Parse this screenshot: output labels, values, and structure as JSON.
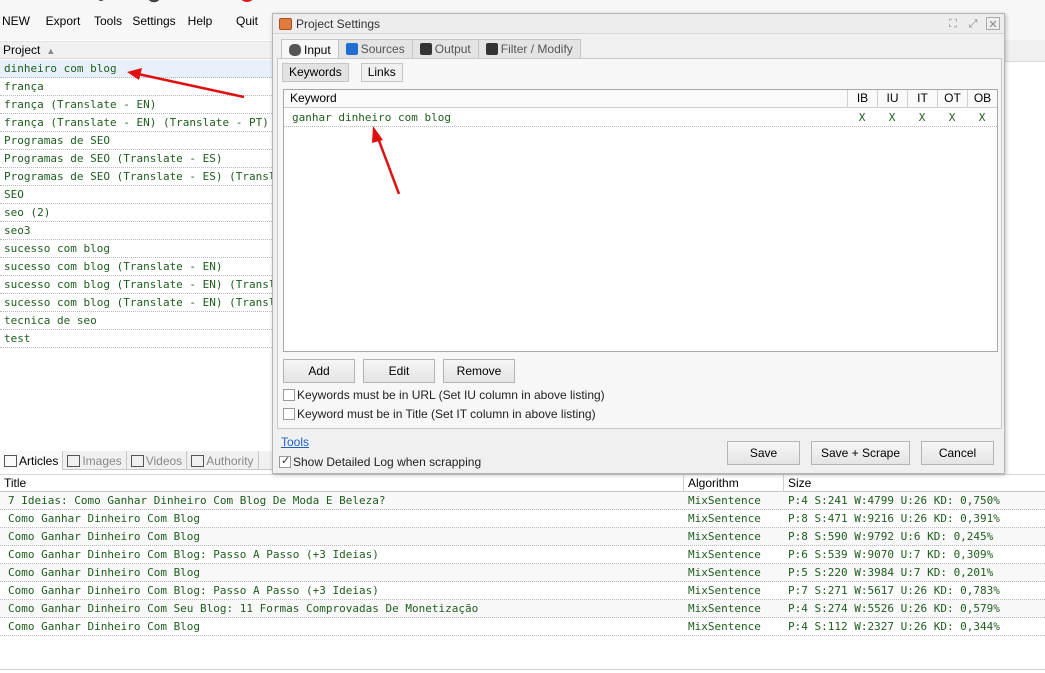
{
  "toolbar": {
    "items": [
      {
        "label": "NEW",
        "icon": "new-file-icon"
      },
      {
        "label": "Export",
        "icon": "excel-export-icon"
      },
      {
        "label": "Tools",
        "icon": "tools-icon"
      },
      {
        "label": "Settings",
        "icon": "gear-icon"
      },
      {
        "label": "Help",
        "icon": "help-person-icon"
      },
      {
        "label": "Quit",
        "icon": "power-icon"
      }
    ]
  },
  "projects": {
    "header": "Project",
    "items": [
      "dinheiro com blog",
      "frança",
      "frança (Translate - EN)",
      "frança (Translate - EN) (Translate - PT)",
      "Programas de SEO",
      "Programas de SEO (Translate - ES)",
      "Programas de SEO (Translate - ES) (Translate - PT)",
      "SEO",
      "seo (2)",
      "seo3",
      "sucesso com blog",
      "sucesso com blog (Translate - EN)",
      "sucesso com blog (Translate - EN) (Translate - PT)",
      "sucesso com blog (Translate - EN) (Translate - ES)",
      "tecnica de seo",
      "test"
    ]
  },
  "dialog": {
    "title": "Project Settings",
    "tabs": [
      {
        "label": "Input",
        "icon": "mouse-icon"
      },
      {
        "label": "Sources",
        "icon": "globe-icon"
      },
      {
        "label": "Output",
        "icon": "download-icon"
      },
      {
        "label": "Filter / Modify",
        "icon": "filter-icon"
      }
    ],
    "subtabs": [
      "Keywords",
      "Links"
    ],
    "table": {
      "columns": [
        "Keyword",
        "IB",
        "IU",
        "IT",
        "OT",
        "OB"
      ],
      "rows": [
        {
          "keyword": "ganhar dinheiro com blog",
          "ib": "X",
          "iu": "X",
          "it": "X",
          "ot": "X",
          "ob": "X"
        }
      ]
    },
    "buttons": {
      "add": "Add",
      "edit": "Edit",
      "remove": "Remove"
    },
    "checkboxes": {
      "url": "Keywords must be in URL (Set IU column in above listing)",
      "title": "Keyword must be in Title (Set IT column in above listing)",
      "log": "Show Detailed Log when scrapping"
    },
    "tools_link": "Tools",
    "footer_buttons": {
      "save": "Save",
      "save_scrape": "Save + Scrape",
      "cancel": "Cancel"
    }
  },
  "bottom_tabs": [
    {
      "label": "Articles",
      "icon": "articles-icon"
    },
    {
      "label": "Images",
      "icon": "image-icon"
    },
    {
      "label": "Videos",
      "icon": "video-icon"
    },
    {
      "label": "Authority",
      "icon": "link-icon"
    }
  ],
  "results": {
    "columns": [
      "Title",
      "Algorithm",
      "Size"
    ],
    "rows": [
      {
        "title": "7 Ideias: Como Ganhar Dinheiro Com Blog De Moda E Beleza?",
        "algorithm": "MixSentence",
        "size": "P:4 S:241 W:4799 U:26 KD: 0,750%"
      },
      {
        "title": "Como Ganhar Dinheiro Com Blog",
        "algorithm": "MixSentence",
        "size": "P:8 S:471 W:9216 U:26 KD: 0,391%"
      },
      {
        "title": "Como Ganhar Dinheiro Com Blog",
        "algorithm": "MixSentence",
        "size": "P:8 S:590 W:9792 U:6 KD: 0,245%"
      },
      {
        "title": "Como Ganhar Dinheiro Com Blog: Passo A Passo (+3 Ideias)",
        "algorithm": "MixSentence",
        "size": "P:6 S:539 W:9070 U:7 KD: 0,309%"
      },
      {
        "title": "Como Ganhar Dinheiro Com Blog",
        "algorithm": "MixSentence",
        "size": "P:5 S:220 W:3984 U:7 KD: 0,201%"
      },
      {
        "title": "Como Ganhar Dinheiro Com Blog: Passo A Passo (+3 Ideias)",
        "algorithm": "MixSentence",
        "size": "P:7 S:271 W:5617 U:26 KD: 0,783%"
      },
      {
        "title": "Como Ganhar Dinheiro Com Seu Blog: 11 Formas Comprovadas De Monetização",
        "algorithm": "MixSentence",
        "size": "P:4 S:274 W:5526 U:26 KD: 0,579%"
      },
      {
        "title": "Como Ganhar Dinheiro Com Blog",
        "algorithm": "MixSentence",
        "size": "P:4 S:112 W:2327 U:26 KD: 0,344%"
      }
    ]
  },
  "colors": {
    "list_text": "#1d5e1d",
    "link": "#1f5fc4",
    "annotation_arrow": "#e01010"
  }
}
